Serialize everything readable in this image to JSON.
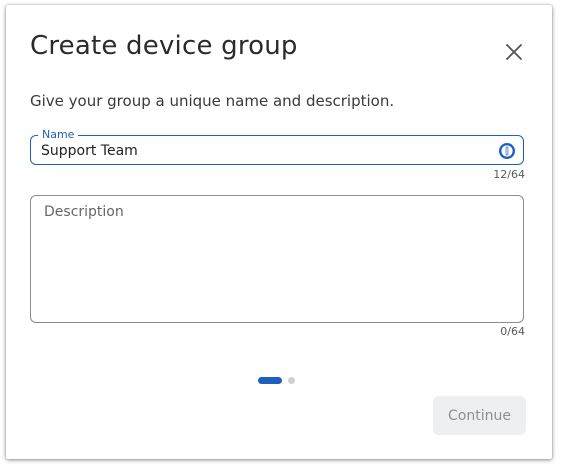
{
  "dialog": {
    "title": "Create device group",
    "subtitle": "Give your group a unique name and description.",
    "close_icon": "close-icon"
  },
  "name_field": {
    "label": "Name",
    "value": "Support Team",
    "counter": "12/64",
    "icon": "password-manager-icon",
    "accent_color": "#1f5fbf"
  },
  "description_field": {
    "placeholder": "Description",
    "value": "",
    "counter": "0/64"
  },
  "pager": {
    "current_step": 1,
    "total_steps": 2
  },
  "footer": {
    "continue_label": "Continue",
    "continue_enabled": false
  }
}
